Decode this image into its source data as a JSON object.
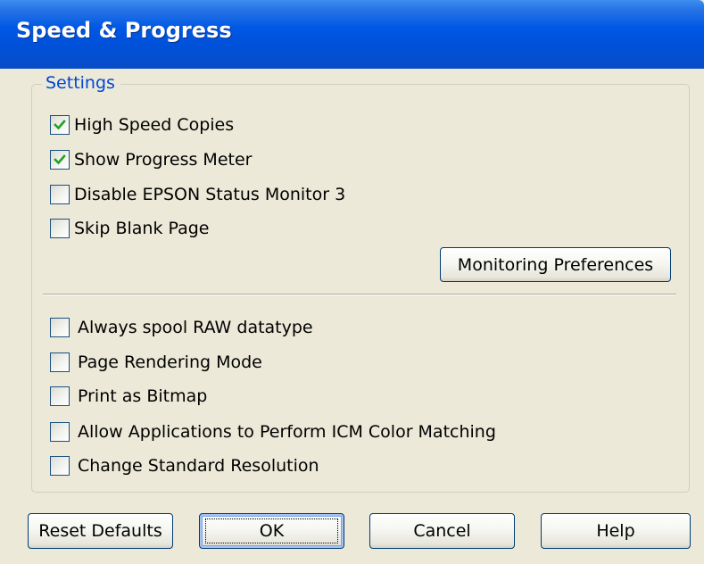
{
  "window": {
    "title": "Speed & Progress"
  },
  "settings_group": {
    "legend": "Settings",
    "options_top": [
      {
        "label": "High Speed Copies",
        "checked": true
      },
      {
        "label": "Show Progress Meter",
        "checked": true
      },
      {
        "label": "Disable EPSON Status Monitor 3",
        "checked": false
      },
      {
        "label": "Skip Blank Page",
        "checked": false
      }
    ],
    "monitoring_button": "Monitoring Preferences",
    "options_bottom": [
      {
        "label": "Always spool RAW datatype",
        "checked": false
      },
      {
        "label": "Page Rendering Mode",
        "checked": false
      },
      {
        "label": "Print as Bitmap",
        "checked": false
      },
      {
        "label": "Allow Applications to Perform ICM Color Matching",
        "checked": false
      },
      {
        "label": "Change Standard Resolution",
        "checked": false
      }
    ]
  },
  "buttons": {
    "reset_defaults": "Reset Defaults",
    "ok": "OK",
    "cancel": "Cancel",
    "help": "Help"
  },
  "colors": {
    "titlebar": "#0054e3",
    "dialog_background": "#ece9d8",
    "group_legend": "#0046d5",
    "checkmark": "#21a121",
    "button_border": "#003c74"
  },
  "icons": {
    "checkmark": "checkmark-icon"
  }
}
